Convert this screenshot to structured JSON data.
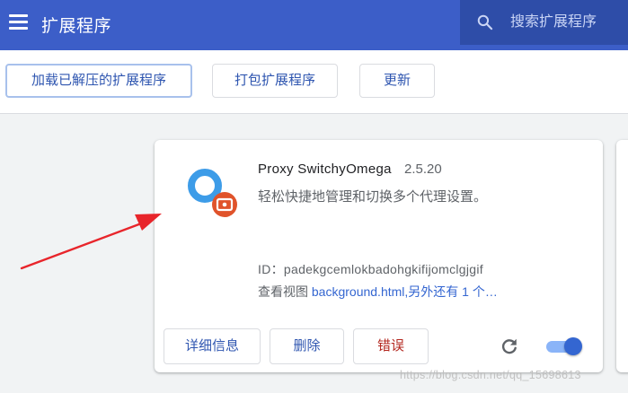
{
  "header": {
    "title": "扩展程序",
    "search_placeholder": "搜索扩展程序"
  },
  "toolbar": {
    "load_unpacked": "加载已解压的扩展程序",
    "pack_extension": "打包扩展程序",
    "update": "更新"
  },
  "extension": {
    "name": "Proxy SwitchyOmega",
    "version": "2.5.20",
    "description": "轻松快捷地管理和切换多个代理设置。",
    "id_label": "ID：",
    "id_value": "padekgcemlokbadohgkifijomclgjgif",
    "views_label": "查看视图",
    "views_link": "background.html,另外还有 1 个…",
    "details_button": "详细信息",
    "remove_button": "删除",
    "errors_button": "错误",
    "enabled": true
  },
  "watermark": "https://blog.csdn.net/qq_15698613",
  "colors": {
    "header": "#3c5ec8",
    "search_bg": "#2e4da8",
    "accent": "#2f56b0",
    "error": "#b3261e",
    "arrow": "#e8252b",
    "icon_ring": "#3d9ce8",
    "icon_badge": "#e0532b"
  },
  "icons": {
    "menu": "hamburger-icon",
    "search": "search-icon",
    "reload": "reload-icon",
    "extension": "switchyomega-logo"
  }
}
